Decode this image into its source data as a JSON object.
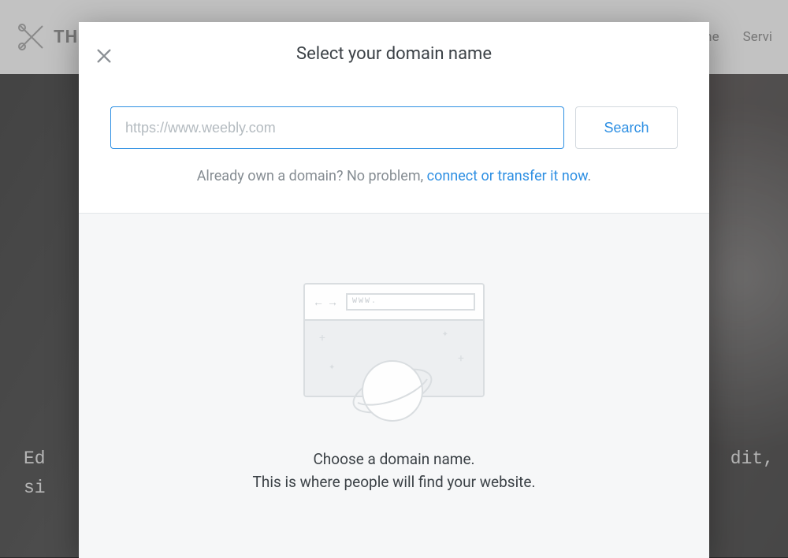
{
  "background": {
    "logo_text": "THCORNER",
    "nav": {
      "home": "Home",
      "services": "Servi"
    },
    "hero_left_line1": "Ed",
    "hero_left_line2": "si",
    "hero_right_line1": "dit,"
  },
  "modal": {
    "title": "Select your domain name",
    "domain_placeholder": "https://www.weebly.com",
    "search_label": "Search",
    "already_own_text": "Already own a domain? No problem, ",
    "already_own_link": "connect or transfer it now",
    "already_own_period": ".",
    "illustration_url_text": "WWW.",
    "body_title": "Choose a domain name.",
    "body_subtitle": "This is where people will find your website."
  }
}
